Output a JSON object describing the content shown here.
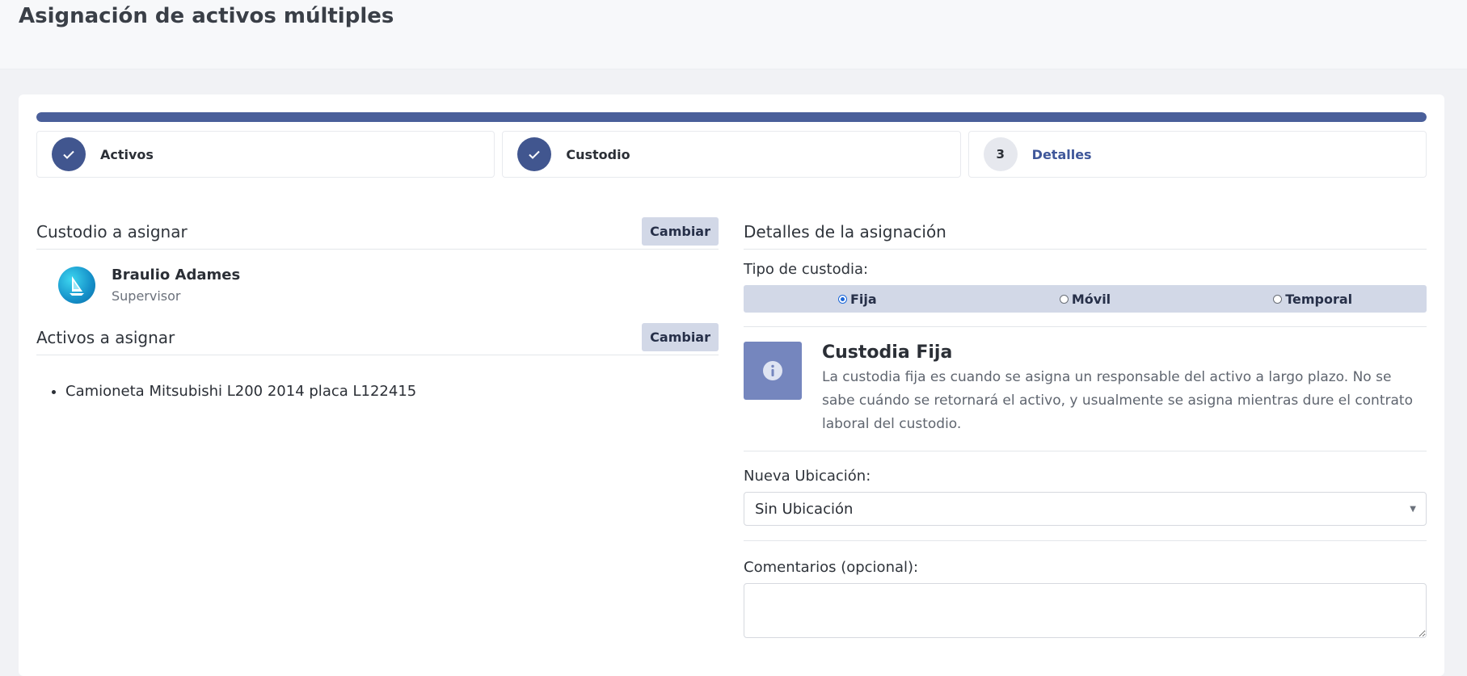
{
  "page": {
    "title": "Asignación de activos múltiples"
  },
  "progress": {
    "fraction": 1.0
  },
  "steps": [
    {
      "label": "Activos",
      "number": "1",
      "status": "done"
    },
    {
      "label": "Custodio",
      "number": "2",
      "status": "done"
    },
    {
      "label": "Detalles",
      "number": "3",
      "status": "current"
    }
  ],
  "custodian_section": {
    "title": "Custodio a asignar",
    "change_label": "Cambiar",
    "name": "Braulio Adames",
    "role": "Supervisor"
  },
  "assets_section": {
    "title": "Activos a asignar",
    "change_label": "Cambiar",
    "items": [
      "Camioneta Mitsubishi L200 2014 placa L122415"
    ]
  },
  "details": {
    "title": "Detalles de la asignación",
    "custody_type_label": "Tipo de custodia:",
    "custody_options": [
      {
        "label": "Fija",
        "checked": true
      },
      {
        "label": "Móvil",
        "checked": false
      },
      {
        "label": "Temporal",
        "checked": false
      }
    ],
    "info_title": "Custodia Fija",
    "info_desc": "La custodia fija es cuando se asigna un responsable del activo a largo plazo. No se sabe cuándo se retornará el activo, y usualmente se asigna mientras dure el contrato laboral del custodio.",
    "location_label": "Nueva Ubicación:",
    "location_value": "Sin Ubicación",
    "comments_label": "Comentarios (opcional):",
    "comments_value": ""
  },
  "colors": {
    "primary": "#41568f",
    "accent_bar": "#d2d8e7",
    "info_icon_bg": "#7586be"
  }
}
